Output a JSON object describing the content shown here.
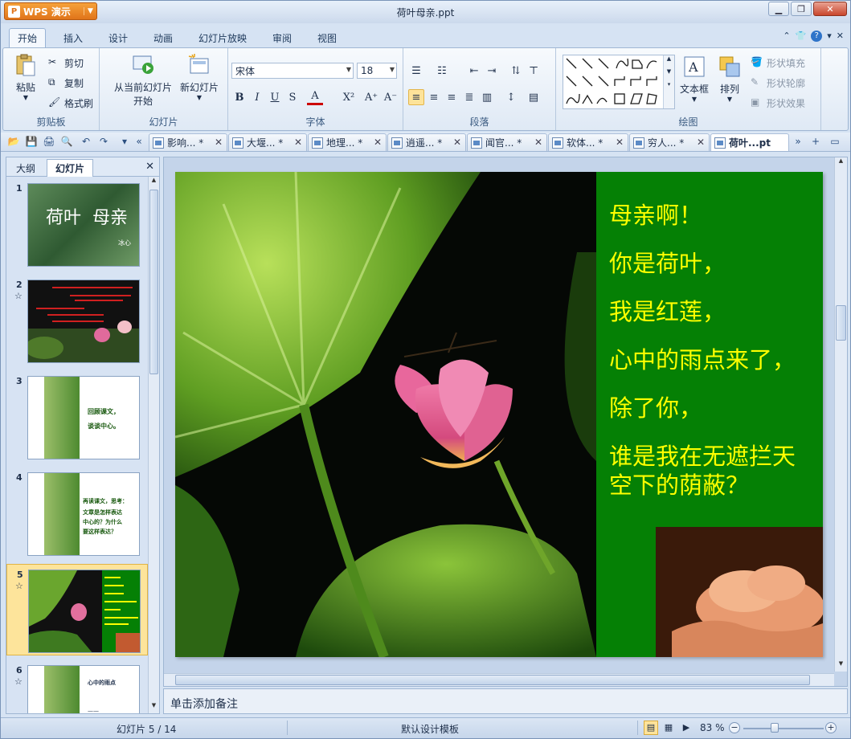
{
  "window": {
    "app_name": "WPS 演示",
    "title": "荷叶母亲.ppt",
    "app_logo_glyph": "P"
  },
  "ribbon_tabs": [
    "开始",
    "插入",
    "设计",
    "动画",
    "幻灯片放映",
    "审阅",
    "视图"
  ],
  "ribbon": {
    "clipboard": {
      "label": "剪贴板",
      "paste": "粘贴",
      "cut": "剪切",
      "copy": "复制",
      "format_painter": "格式刷"
    },
    "slides": {
      "label": "幻灯片",
      "from_current_l1": "从当前幻灯片",
      "from_current_l2": "开始",
      "new_slide": "新幻灯片"
    },
    "font": {
      "label": "字体",
      "font_name": "宋体",
      "font_size": "18",
      "bold": "B",
      "italic": "I",
      "underline": "U",
      "shadow": "S",
      "color": "A",
      "superscript": "X²",
      "grow": "A⁺",
      "shrink": "A⁻"
    },
    "paragraph": {
      "label": "段落"
    },
    "drawing": {
      "label": "绘图",
      "textbox": "文本框",
      "arrange": "排列",
      "shape_fill": "形状填充",
      "shape_outline": "形状轮廓",
      "shape_effect": "形状效果"
    }
  },
  "doc_tabs": [
    {
      "label": "影响... *"
    },
    {
      "label": "大堰... *"
    },
    {
      "label": "地理... *"
    },
    {
      "label": "逍遥... *"
    },
    {
      "label": "闻官... *"
    },
    {
      "label": "软体... *"
    },
    {
      "label": "穷人... *"
    },
    {
      "label": "荷叶...pt"
    }
  ],
  "left_panel": {
    "tab_outline": "大纲",
    "tab_slides": "幻灯片",
    "thumbs": [
      {
        "num": "1",
        "title": "荷叶  母亲",
        "sub": "冰心"
      },
      {
        "num": "2",
        "star": "☆"
      },
      {
        "num": "3",
        "lines": [
          "回顾课文，",
          "谈谈中心。"
        ]
      },
      {
        "num": "4",
        "lines": [
          "再读课文，思考：",
          "文章是怎样表达",
          "中心的？为什么",
          "要这样表达？"
        ]
      },
      {
        "num": "5",
        "star": "☆"
      },
      {
        "num": "6",
        "star": "☆",
        "lines": [
          "心中的雨点",
          "——"
        ]
      }
    ]
  },
  "slide": {
    "lines": [
      "母亲啊！",
      "你是荷叶，",
      "我是红莲，",
      "心中的雨点来了，",
      "除了你，",
      "谁是我在无遮拦天",
      "空下的荫蔽？"
    ]
  },
  "notes_placeholder": "单击添加备注",
  "status": {
    "slide_pos": "幻灯片 5 / 14",
    "template": "默认设计模板",
    "zoom": "83 %"
  },
  "colors": {
    "slide_text": "#ffff00",
    "slide_panel": "#058005",
    "app_accent": "#e0741a"
  }
}
